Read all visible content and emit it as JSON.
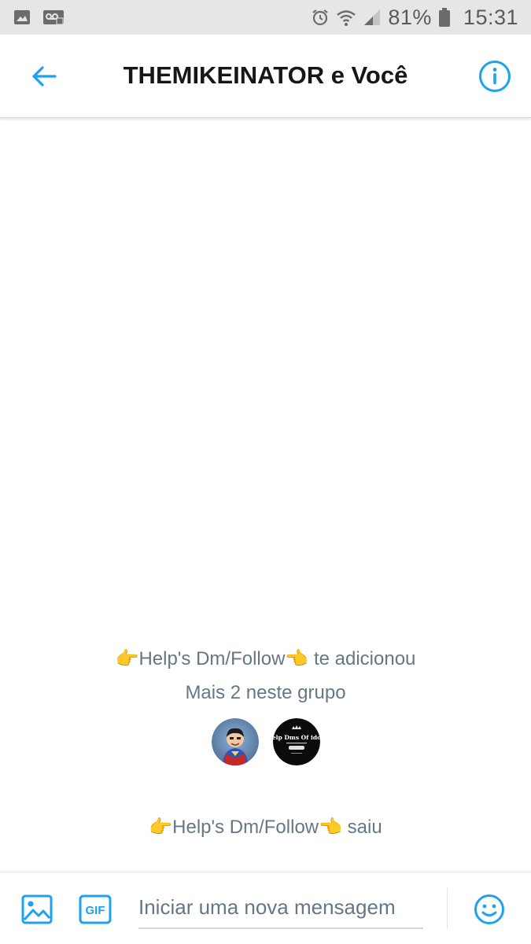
{
  "status_bar": {
    "battery_percent": "81%",
    "time": "15:31",
    "icons": [
      "image-icon",
      "voicemail-icon",
      "alarm-icon",
      "wifi-icon",
      "signal-icon",
      "battery-icon"
    ]
  },
  "header": {
    "title": "THEMIKEINATOR e Você",
    "back_icon": "back-arrow-icon",
    "info_icon": "info-icon"
  },
  "conversation": {
    "events": [
      {
        "text": "👉Help's Dm/Follow👈 te adicionou"
      },
      {
        "text": "Mais 2 neste grupo"
      },
      {
        "text": "👉Help's Dm/Follow👈 saiu"
      }
    ],
    "avatars": [
      {
        "name": "superhero-avatar"
      },
      {
        "name": "help-dms-logo-avatar",
        "logo_text": "Help Dms Of idols"
      }
    ]
  },
  "composer": {
    "placeholder": "Iniciar uma nova mensagem",
    "value": "",
    "gif_label": "GIF",
    "accent_color": "#1da1f2"
  },
  "colors": {
    "accent": "#1da1f2",
    "status_bar_bg": "#e6e6e6",
    "event_text": "#657786"
  }
}
